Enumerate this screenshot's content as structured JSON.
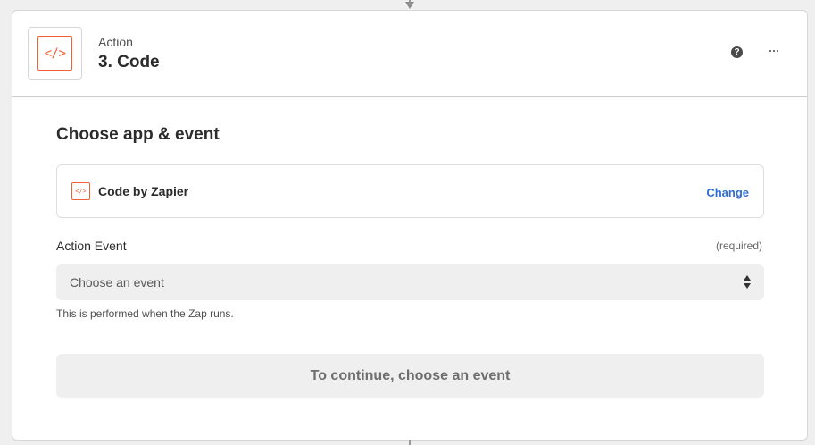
{
  "step": {
    "type_label": "Action",
    "title": "3. Code",
    "icon": "code-icon"
  },
  "header_actions": {
    "help_icon_glyph": "?",
    "help_icon": "question-circle-icon",
    "more_icon": "more-horizontal-icon"
  },
  "section": {
    "title": "Choose app & event"
  },
  "app": {
    "name": "Code by Zapier",
    "icon": "code-icon",
    "change_label": "Change"
  },
  "event_field": {
    "label": "Action Event",
    "required_label": "(required)",
    "placeholder": "Choose an event",
    "helper": "This is performed when the Zap runs."
  },
  "continue_button": {
    "label": "To continue, choose an event"
  },
  "colors": {
    "accent_orange": "#f05f36",
    "link_blue": "#2f6dd3"
  }
}
